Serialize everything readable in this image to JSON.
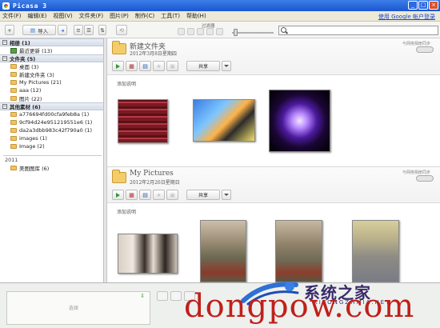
{
  "window": {
    "title": "Picasa 3"
  },
  "menu": {
    "items": [
      "文件(F)",
      "编辑(E)",
      "视图(V)",
      "文件夹(F)",
      "图片(P)",
      "制作(C)",
      "工具(T)",
      "帮助(H)"
    ],
    "signin": "使用 Google 帐户登录"
  },
  "toolbar": {
    "import_label": "导入",
    "filter_label": "过滤器"
  },
  "sidebar": {
    "albums_header": "相册 (1)",
    "albums": [
      {
        "label": "最近更新 (13)"
      }
    ],
    "folders_header": "文件夹 (5)",
    "folders": [
      {
        "label": "桌面 (3)"
      },
      {
        "label": "新建文件夹 (3)"
      },
      {
        "label": "My Pictures (21)"
      },
      {
        "label": "aaa (12)"
      },
      {
        "label": "图片 (22)"
      }
    ],
    "other_header": "其他素材 (6)",
    "other": [
      {
        "label": "a776694fd00cfa9feb8a (1)"
      },
      {
        "label": "9cf94d24e951219551e6 (1)"
      },
      {
        "label": "da2a3dbb983c42f790a0 (1)"
      },
      {
        "label": "images (1)"
      },
      {
        "label": "Image (2)"
      }
    ],
    "year": "2011",
    "year_items": [
      {
        "label": "美图图库 (6)"
      }
    ]
  },
  "albums": [
    {
      "title": "新建文件夹",
      "date": "2012年3月8日星期四",
      "sync_label": "与网络相册同步",
      "share_label": "共享",
      "caption": "添加说明"
    },
    {
      "title": "My Pictures",
      "date": "2012年2月26日星期日",
      "sync_label": "与网络相册同步",
      "share_label": "共享",
      "caption": "添加说明"
    }
  ],
  "tray": {
    "label": "选择"
  },
  "watermark": {
    "brand": "系统之家",
    "sub": "XITONGZHIJIA.NET",
    "url": "dongpow.com"
  }
}
